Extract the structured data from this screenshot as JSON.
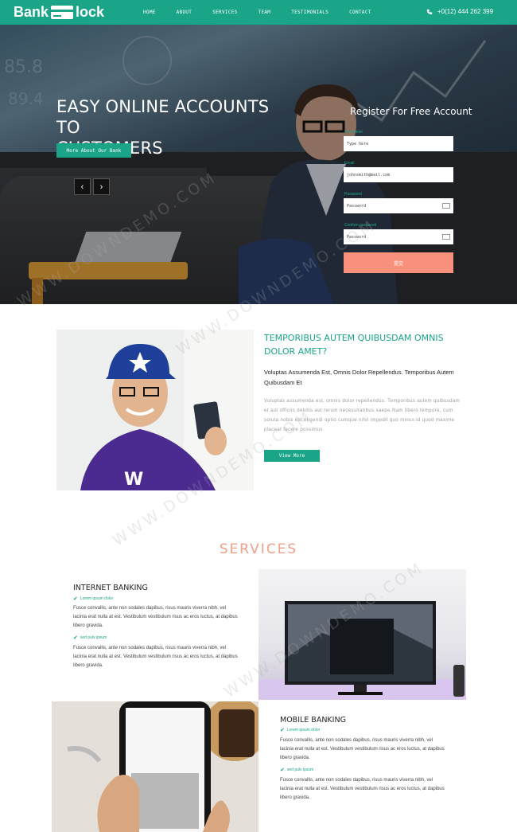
{
  "nav": {
    "brand_left": "Bank",
    "brand_right": "lock",
    "menu": [
      "HOME",
      "ABOUT",
      "SERVICES",
      "TEAM",
      "TESTIMONIALS",
      "CONTACT"
    ],
    "phone": "+0(12) 444 262 399",
    "bg_color": "#1ba588"
  },
  "hero": {
    "title_line1": "EASY ONLINE ACCOUNTS TO",
    "title_line2": "CUSTOMERS",
    "button": "More About Our Bank",
    "prev": "‹",
    "next": "›"
  },
  "register": {
    "title": "Register For Free Account",
    "fields": [
      {
        "label": "Username",
        "placeholder": "Type here"
      },
      {
        "label": "Email",
        "value": "johnsmith@mail.com"
      },
      {
        "label": "Password",
        "placeholder": "Password"
      },
      {
        "label": "Confirm password",
        "placeholder": "Password"
      }
    ],
    "submit": "提交"
  },
  "about": {
    "title": "TEMPORIBUS AUTEM QUIBUSDAM OMNIS DOLOR AMET?",
    "subtitle": "Voluptas Assumenda Est, Omnis Dolor Repellendus. Temporibus Autem Quibusdam Et",
    "text": "Voluptas assumenda est, omnis dolor repellendus. Temporibus autem quibusdam et aut officiis debitis aut rerum necessitatibus saepe.Nam libero tempore, cum soluta nobis est eligendi optio cumque nihil impedit quo minus id quod maxime placeat facere possimus",
    "button": "View More"
  },
  "services": {
    "title": "SERVICES",
    "items": [
      {
        "heading": "INTERNET BANKING",
        "check1": "Lorem ipsum dolor",
        "para1": "Fusce convallis, ante non sodales dapibus, risus mauris viverra nibh, vel lacinia erat nulla at est. Vestibulum vestibulum risus ac eros luctus, at dapibus libero gravida.",
        "check2": "sed pulv ipsum",
        "para2": "Fusce convallis, ante non sodales dapibus, risus mauris viverra nibh, vel lacinia erat nulla at est. Vestibulum vestibulum risus ac eros luctus, at dapibus libero gravida."
      },
      {
        "heading": "MOBILE BANKING",
        "check1": "Lorem ipsum dolor",
        "para1": "Fusce convallis, ante non sodales dapibus, risus mauris viverra nibh, vel lacinia erat nulla at est. Vestibulum vestibulum risus ac eros luctus, at dapibus libero gravida.",
        "check2": "sed pulv ipsum",
        "para2": "Fusce convallis, ante non sodales dapibus, risus mauris viverra nibh, vel lacinia erat nulla at est. Vestibulum vestibulum risus ac eros luctus, at dapibus libero gravida."
      }
    ]
  },
  "watermark": "WWW.DOWNDEMO.COM"
}
